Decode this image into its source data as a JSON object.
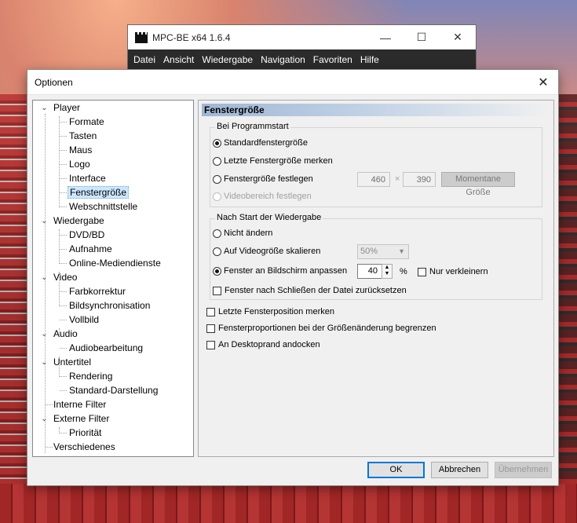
{
  "player": {
    "title": "MPC-BE x64 1.6.4",
    "menu": [
      "Datei",
      "Ansicht",
      "Wiedergabe",
      "Navigation",
      "Favoriten",
      "Hilfe"
    ],
    "min": "—",
    "max": "☐",
    "close": "✕"
  },
  "dialog": {
    "title": "Optionen",
    "close": "✕",
    "buttons": {
      "ok": "OK",
      "cancel": "Abbrechen",
      "apply": "Übernehmen"
    }
  },
  "tree": {
    "player": "Player",
    "formate": "Formate",
    "tasten": "Tasten",
    "maus": "Maus",
    "logo": "Logo",
    "interface": "Interface",
    "fenstergroesse": "Fenstergröße",
    "webschnittstelle": "Webschnittstelle",
    "wiedergabe": "Wiedergabe",
    "dvdbd": "DVD/BD",
    "aufnahme": "Aufnahme",
    "online": "Online-Mediendienste",
    "video": "Video",
    "farbkorrektur": "Farbkorrektur",
    "bildsync": "Bildsynchronisation",
    "vollbild": "Vollbild",
    "audio": "Audio",
    "audiobearbeitung": "Audiobearbeitung",
    "untertitel": "Untertitel",
    "rendering": "Rendering",
    "standard": "Standard-Darstellung",
    "internefilter": "Interne Filter",
    "externefilter": "Externe Filter",
    "prioritaet": "Priorität",
    "verschiedenes": "Verschiedenes",
    "collapse_glyph": "⌄"
  },
  "page": {
    "header": "Fenstergröße",
    "startup": {
      "legend": "Bei Programmstart",
      "opt_default": "Standardfenstergröße",
      "opt_remember": "Letzte Fenstergröße merken",
      "opt_fixed": "Fenstergröße festlegen",
      "opt_videoarea": "Videobereich festlegen",
      "width": "460",
      "times": "×",
      "height": "390",
      "current_size_button": "Momentane Größe"
    },
    "after_start": {
      "legend": "Nach Start der Wiedergabe",
      "opt_nochange": "Nicht ändern",
      "opt_scale": "Auf Videogröße skalieren",
      "scale_value": "50%",
      "opt_fit": "Fenster an Bildschirm anpassen",
      "fit_value": "40",
      "percent": "%",
      "only_shrink": "Nur verkleinern",
      "reset_on_close": "Fenster nach Schließen der Datei zurücksetzen"
    },
    "remember_position": "Letzte Fensterposition merken",
    "limit_proportions": "Fensterproportionen bei der Größenänderung begrenzen",
    "snap_desktop": "An Desktoprand andocken"
  }
}
